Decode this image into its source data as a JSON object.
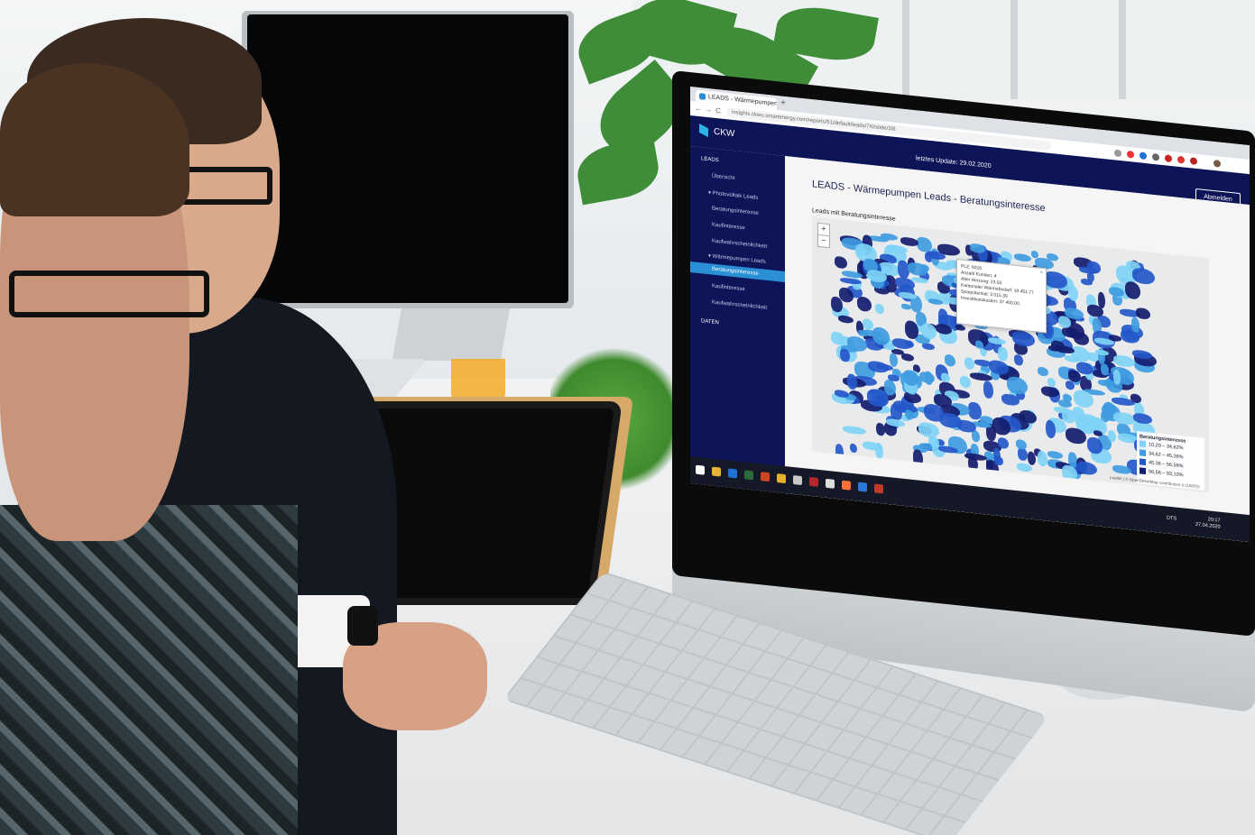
{
  "browser": {
    "tab_title": "LEADS - Wärmepumpen Leads",
    "new_tab": "+",
    "url": "insights.ckwu.smartenergy.com/reports/51/default/leads/7/0/slide/3/8",
    "back": "←",
    "forward": "→",
    "reload": "C"
  },
  "app": {
    "brand": "CKW",
    "last_update": "letztes Update: 29.02.2020",
    "logout_label": "Abmelden"
  },
  "sidebar": {
    "items": [
      {
        "label": "LEADS"
      },
      {
        "label": "Übersicht"
      },
      {
        "label": "▾ Photovoltaik Leads"
      },
      {
        "label": "Beratungsinteresse"
      },
      {
        "label": "Kaufinteresse"
      },
      {
        "label": "Kaufwahrscheinlichkeit"
      },
      {
        "label": "▾ Wärmepumpen Leads"
      },
      {
        "label": "Beratungsinteresse"
      },
      {
        "label": "Kaufinteresse"
      },
      {
        "label": "Kaufwahrscheinlichkeit"
      },
      {
        "label": "DATEN"
      }
    ],
    "active_index": 7
  },
  "main": {
    "page_title": "LEADS - Wärmepumpen Leads - Beratungsinteresse",
    "map_title": "Leads mit Beratungsinteresse",
    "zoom_in": "+",
    "zoom_out": "−",
    "popup": {
      "close": "×",
      "lines": [
        "PLZ: 6016",
        "Anzahl Kunden: 4",
        "Alter Heizung: 23.50",
        "Kantonaler Wärmebedarf: 19 451.77",
        "Sparpotential: 3 015.30",
        "Investitionskosten: 37 400.00"
      ]
    },
    "legend": {
      "title": "Beratungsinteresse",
      "rows": [
        {
          "label": "10,20 – 34,62%",
          "color": "#7fd3f5"
        },
        {
          "label": "34,62 – 45,36%",
          "color": "#3f9be0"
        },
        {
          "label": "45,36 – 56,56%",
          "color": "#2457c9"
        },
        {
          "label": "56,56 – 93,10%",
          "color": "#141c6e"
        }
      ]
    },
    "attribution": "Leaflet | © OpenStreetMap contributors © CARTO"
  },
  "taskbar": {
    "lang": "DTS",
    "time": "20:17",
    "date": "27.04.2020"
  },
  "colors": {
    "app_navy": "#0d1457",
    "accent_blue": "#2a8fd4",
    "logo_cyan": "#2bb3e6"
  }
}
